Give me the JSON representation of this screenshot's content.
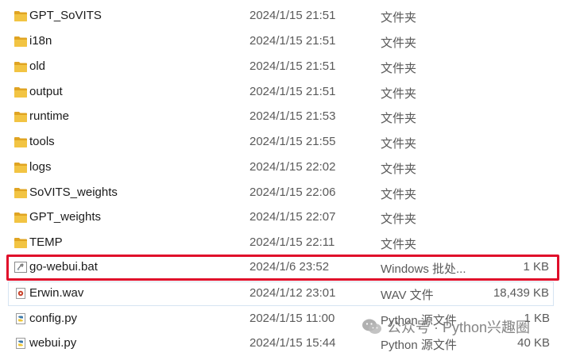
{
  "files": [
    {
      "name": "GPT_SoVITS",
      "date": "2024/1/15 21:51",
      "type": "文件夹",
      "size": "",
      "icon": "folder-icon"
    },
    {
      "name": "i18n",
      "date": "2024/1/15 21:51",
      "type": "文件夹",
      "size": "",
      "icon": "folder-icon"
    },
    {
      "name": "old",
      "date": "2024/1/15 21:51",
      "type": "文件夹",
      "size": "",
      "icon": "folder-icon"
    },
    {
      "name": "output",
      "date": "2024/1/15 21:51",
      "type": "文件夹",
      "size": "",
      "icon": "folder-icon"
    },
    {
      "name": "runtime",
      "date": "2024/1/15 21:53",
      "type": "文件夹",
      "size": "",
      "icon": "folder-icon"
    },
    {
      "name": "tools",
      "date": "2024/1/15 21:55",
      "type": "文件夹",
      "size": "",
      "icon": "folder-icon"
    },
    {
      "name": "logs",
      "date": "2024/1/15 22:02",
      "type": "文件夹",
      "size": "",
      "icon": "folder-icon"
    },
    {
      "name": "SoVITS_weights",
      "date": "2024/1/15 22:06",
      "type": "文件夹",
      "size": "",
      "icon": "folder-icon"
    },
    {
      "name": "GPT_weights",
      "date": "2024/1/15 22:07",
      "type": "文件夹",
      "size": "",
      "icon": "folder-icon"
    },
    {
      "name": "TEMP",
      "date": "2024/1/15 22:11",
      "type": "文件夹",
      "size": "",
      "icon": "folder-icon"
    },
    {
      "name": "go-webui.bat",
      "date": "2024/1/6 23:52",
      "type": "Windows 批处...",
      "size": "1 KB",
      "icon": "batch-file-icon"
    },
    {
      "name": "Erwin.wav",
      "date": "2024/1/12 23:01",
      "type": "WAV 文件",
      "size": "18,439 KB",
      "icon": "audio-file-icon"
    },
    {
      "name": "config.py",
      "date": "2024/1/15 11:00",
      "type": "Python 源文件",
      "size": "1 KB",
      "icon": "python-file-icon"
    },
    {
      "name": "webui.py",
      "date": "2024/1/15 15:44",
      "type": "Python 源文件",
      "size": "40 KB",
      "icon": "python-file-icon"
    }
  ],
  "watermark": {
    "text": "公众号 · Python兴趣圈",
    "icon": "wechat-icon"
  },
  "colors": {
    "folder": "#f2c443",
    "folder_back": "#e0a422",
    "highlight_border": "#e00d2a",
    "hover_border": "#d6e4f2"
  }
}
